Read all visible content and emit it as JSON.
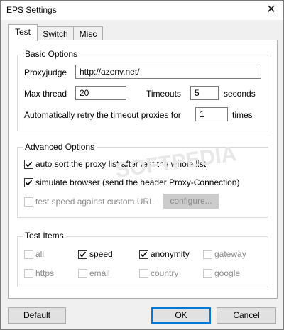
{
  "window": {
    "title": "EPS Settings",
    "close_glyph": "✕"
  },
  "tabs": [
    {
      "label": "Test",
      "active": true
    },
    {
      "label": "Switch",
      "active": false
    },
    {
      "label": "Misc",
      "active": false
    }
  ],
  "basic": {
    "group_label": "Basic Options",
    "proxyjudge_label": "Proxyjudge",
    "proxyjudge_value": "http://azenv.net/",
    "max_thread_label": "Max thread",
    "max_thread_value": "20",
    "timeouts_label": "Timeouts",
    "timeouts_value": "5",
    "seconds_label": "seconds",
    "retry_label": "Automatically retry the timeout proxies for",
    "retry_value": "1",
    "times_label": "times"
  },
  "advanced": {
    "group_label": "Advanced Options",
    "auto_sort": {
      "label": "auto sort the proxy list after test the whole list",
      "checked": true
    },
    "simulate_browser": {
      "label": "simulate browser (send the header Proxy-Connection)",
      "checked": true
    },
    "test_speed": {
      "label": "test speed against custom URL",
      "checked": false,
      "disabled": true
    },
    "configure_label": "configure..."
  },
  "test_items": {
    "group_label": "Test Items",
    "items": [
      {
        "label": "all",
        "checked": false,
        "disabled": true
      },
      {
        "label": "speed",
        "checked": true,
        "disabled": false
      },
      {
        "label": "anonymity",
        "checked": true,
        "disabled": false
      },
      {
        "label": "gateway",
        "checked": false,
        "disabled": true
      },
      {
        "label": "https",
        "checked": false,
        "disabled": true
      },
      {
        "label": "email",
        "checked": false,
        "disabled": true
      },
      {
        "label": "country",
        "checked": false,
        "disabled": true
      },
      {
        "label": "google",
        "checked": false,
        "disabled": true
      }
    ]
  },
  "buttons": {
    "default": "Default",
    "ok": "OK",
    "cancel": "Cancel"
  },
  "watermark": "SOFTPEDIA"
}
